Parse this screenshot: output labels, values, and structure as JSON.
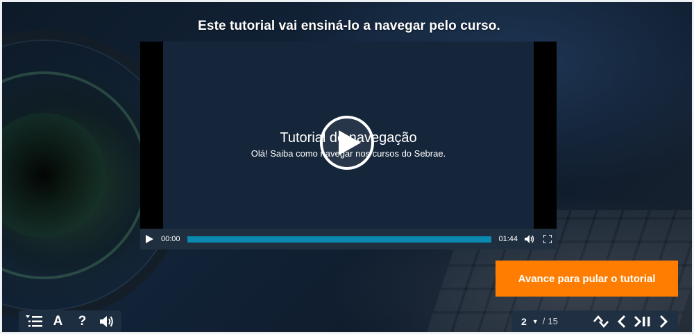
{
  "heading": "Este tutorial vai ensiná-lo a navegar pelo curso.",
  "video": {
    "title": "Tutorial de navegação",
    "subtitle": "Olá! Saiba como navegar nos cursos do Sebrae.",
    "current_time": "00:00",
    "duration": "01:44",
    "progress": 1.0,
    "progress_color": "#0a8ab0"
  },
  "skip_button": {
    "label": "Avance para pular o tutorial",
    "color": "#ff7d00"
  },
  "toolbar_left": {
    "icons": [
      "menu-icon",
      "font-size-icon",
      "help-icon",
      "audio-icon"
    ],
    "font_label": "A",
    "help_label": "?"
  },
  "pagination": {
    "current": "2",
    "separator": "/",
    "total": "15"
  },
  "toolbar_right": {
    "icons": [
      "collapse-expand-icon",
      "previous-icon",
      "skip-pause-icon",
      "next-icon"
    ]
  }
}
